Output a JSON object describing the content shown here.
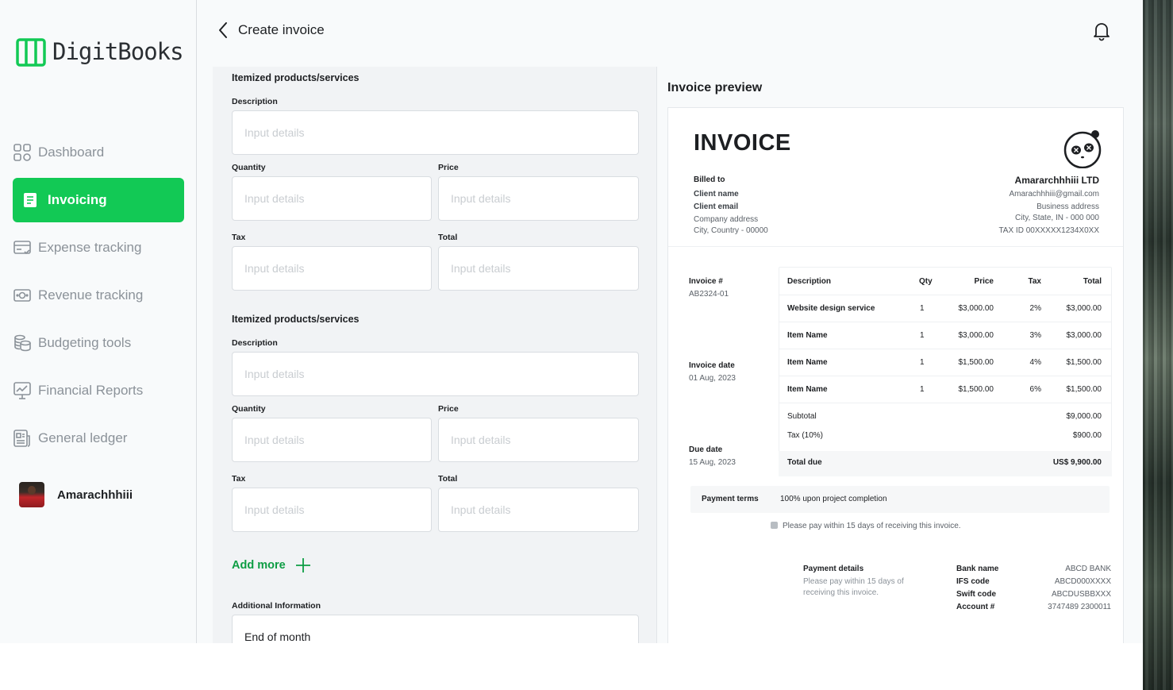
{
  "brand": {
    "name": "DigitBooks",
    "accent": "#12c955"
  },
  "header": {
    "title": "Create invoice"
  },
  "sidebar": {
    "items": [
      {
        "label": "Dashboard",
        "icon": "dashboard-grid-icon"
      },
      {
        "label": "Invoicing",
        "icon": "invoice-icon",
        "active": true
      },
      {
        "label": "Expense tracking",
        "icon": "expense-card-icon"
      },
      {
        "label": "Revenue tracking",
        "icon": "money-icon"
      },
      {
        "label": "Budgeting tools",
        "icon": "coins-icon"
      },
      {
        "label": "Financial Reports",
        "icon": "chart-presentation-icon"
      },
      {
        "label": "General ledger",
        "icon": "ledger-icon"
      }
    ],
    "user": {
      "name": "Amarachhhiii"
    }
  },
  "form": {
    "section1": {
      "title": "Itemized products/services",
      "description_label": "Description",
      "quantity_label": "Quantity",
      "price_label": "Price",
      "tax_label": "Tax",
      "total_label": "Total",
      "placeholder": "Input details"
    },
    "section2": {
      "title": "Itemized products/services",
      "description_label": "Description",
      "quantity_label": "Quantity",
      "price_label": "Price",
      "tax_label": "Tax",
      "total_label": "Total",
      "placeholder": "Input details"
    },
    "add_more": "Add more",
    "additional_label": "Additional Information",
    "additional_value": "End of month"
  },
  "preview": {
    "title": "Invoice preview",
    "invoice_heading": "INVOICE",
    "billed_to_label": "Billed to",
    "client_name": "Client name",
    "client_email": "Client email",
    "company_address": "Company address",
    "client_city": "City, Country - 00000",
    "company": {
      "name": "Amararchhhiii LTD",
      "email": "Amarachhhiii@gmail.com",
      "address": "Business address",
      "city": "City, State, IN - 000 000",
      "tax_id": "TAX ID 00XXXXX1234X0XX"
    },
    "invoice_number_label": "Invoice #",
    "invoice_number": "AB2324-01",
    "invoice_date_label": "Invoice date",
    "invoice_date": "01 Aug, 2023",
    "due_date_label": "Due date",
    "due_date": "15 Aug, 2023",
    "columns": {
      "description": "Description",
      "qty": "Qty",
      "price": "Price",
      "tax": "Tax",
      "total": "Total"
    },
    "rows": [
      {
        "description": "Website design service",
        "qty": "1",
        "price": "$3,000.00",
        "tax": "2%",
        "total": "$3,000.00"
      },
      {
        "description": "Item Name",
        "qty": "1",
        "price": "$3,000.00",
        "tax": "3%",
        "total": "$3,000.00"
      },
      {
        "description": "Item Name",
        "qty": "1",
        "price": "$1,500.00",
        "tax": "4%",
        "total": "$1,500.00"
      },
      {
        "description": "Item Name",
        "qty": "1",
        "price": "$1,500.00",
        "tax": "6%",
        "total": "$1,500.00"
      }
    ],
    "subtotal_label": "Subtotal",
    "subtotal": "$9,000.00",
    "tax_label": "Tax (10%)",
    "tax_value": "$900.00",
    "total_due_label": "Total due",
    "total_due": "US$ 9,900.00",
    "payment_terms_label": "Payment terms",
    "payment_terms": "100% upon project completion",
    "pay_note": "Please pay within 15 days of receiving this invoice.",
    "payment_details_label": "Payment details",
    "payment_details_note_1": "Please pay within 15 days of",
    "payment_details_note_2": "receiving this invoice.",
    "bank": [
      {
        "label": "Bank name",
        "value": "ABCD BANK"
      },
      {
        "label": "IFS code",
        "value": "ABCD000XXXX"
      },
      {
        "label": "Swift code",
        "value": "ABCDUSBBXXX"
      },
      {
        "label": "Account #",
        "value": "3747489 2300011"
      }
    ]
  }
}
